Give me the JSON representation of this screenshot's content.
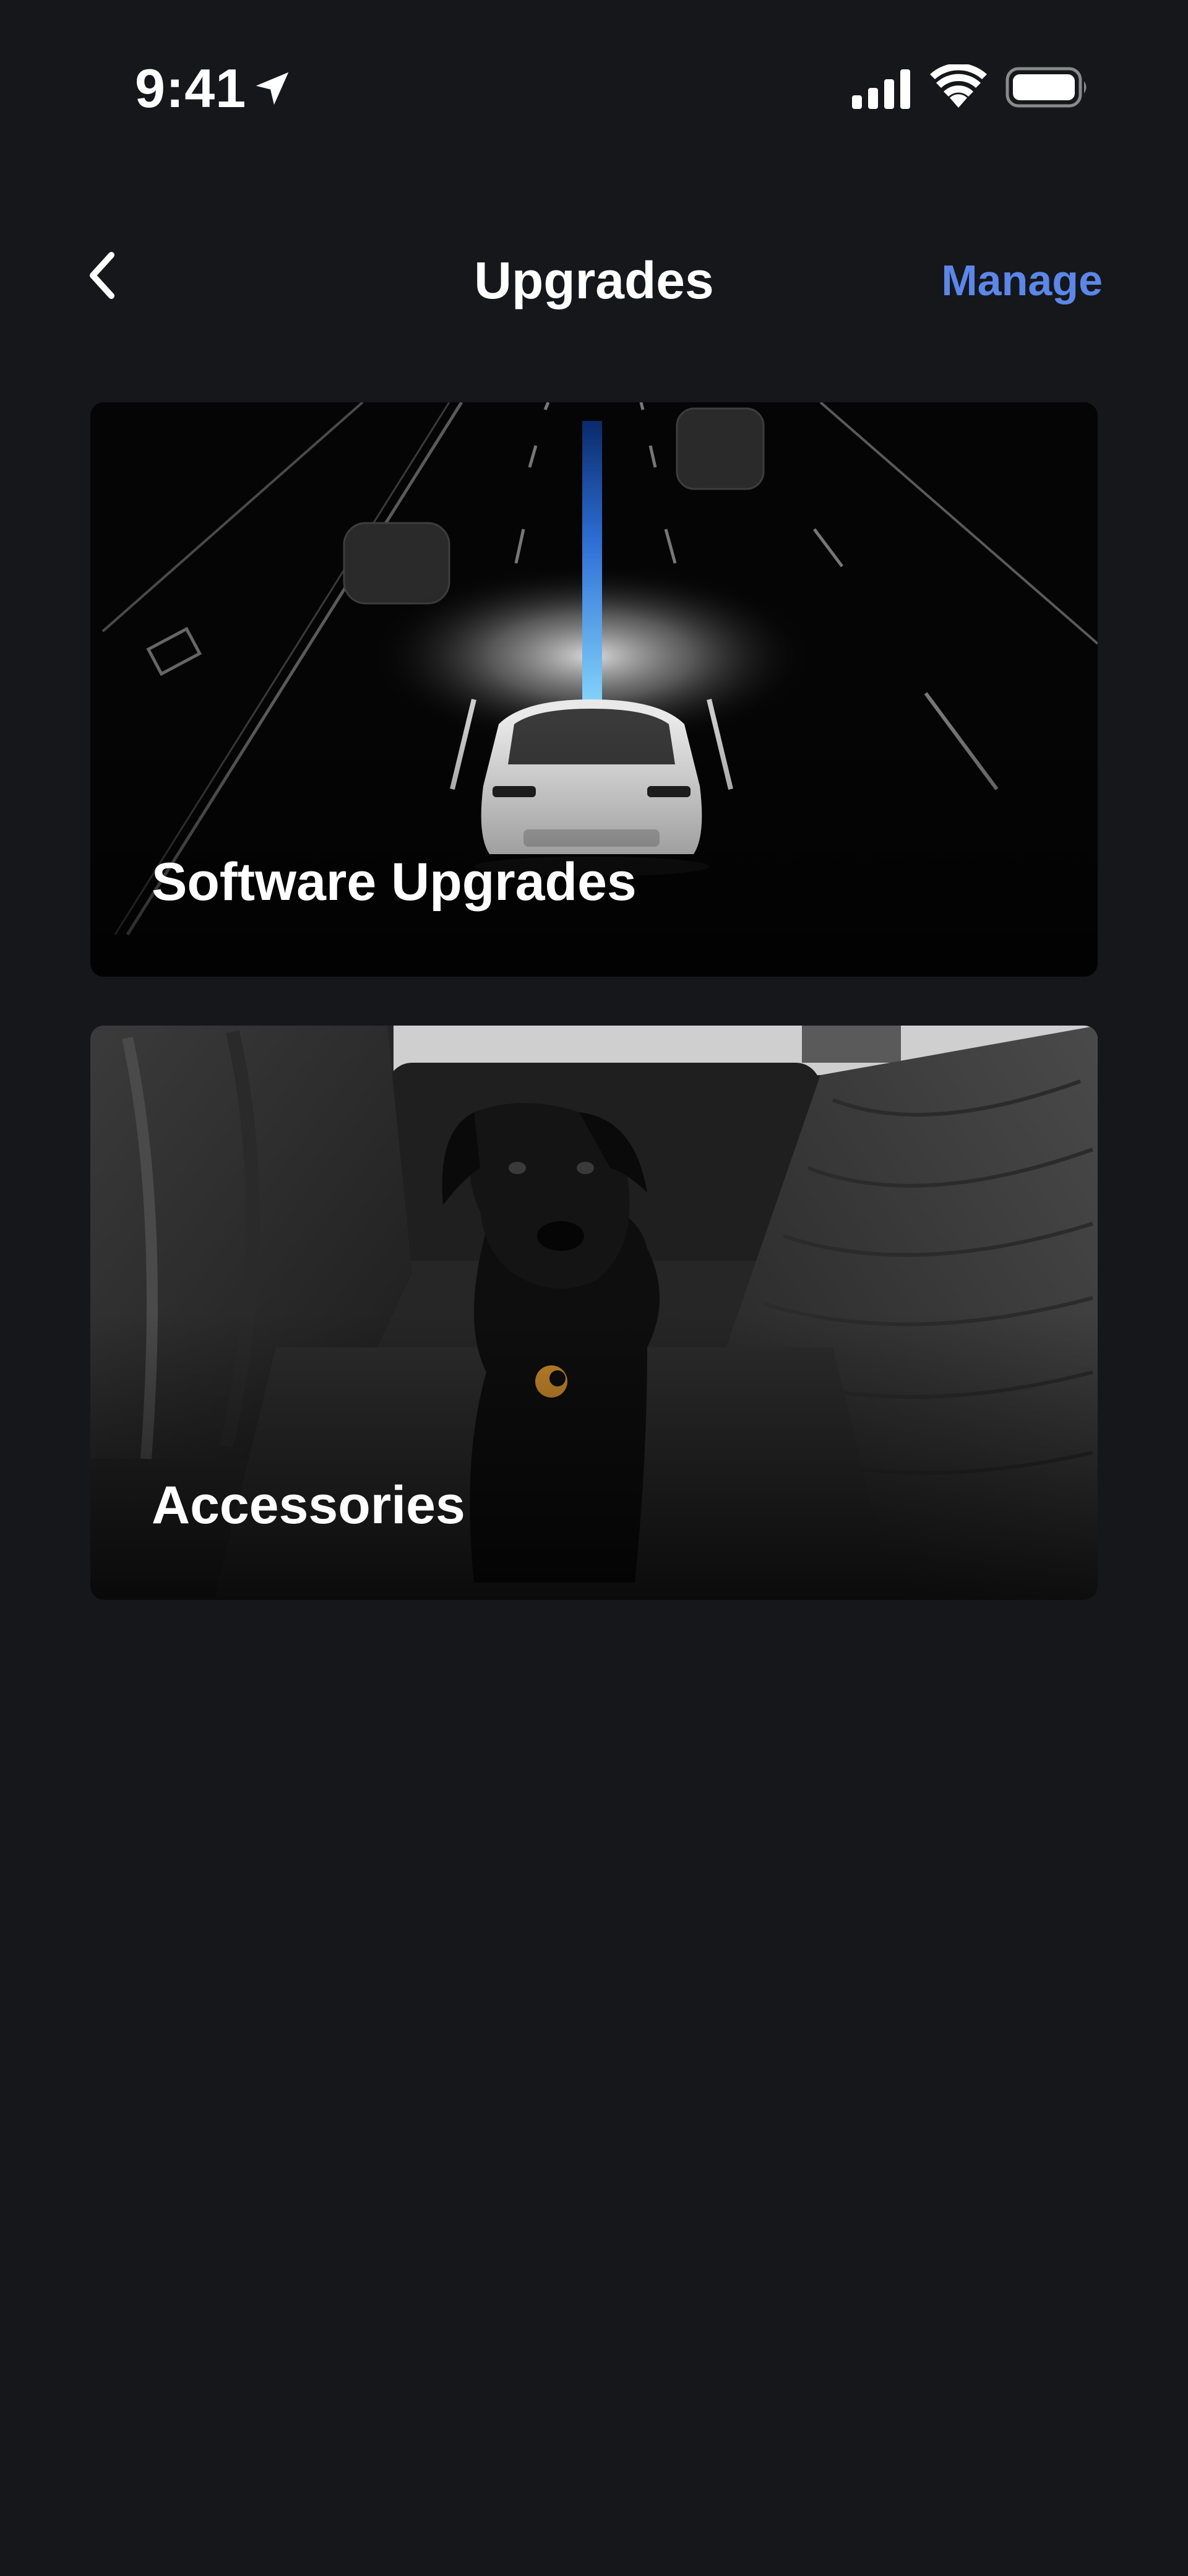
{
  "status_bar": {
    "time": "9:41",
    "icons": [
      "location-arrow-icon",
      "cellular-signal-icon",
      "wifi-icon",
      "battery-icon"
    ]
  },
  "nav": {
    "back_icon": "chevron-left-icon",
    "title": "Upgrades",
    "manage_label": "Manage"
  },
  "cards": [
    {
      "label": "Software Upgrades",
      "image": "highway-car-illustration"
    },
    {
      "label": "Accessories",
      "image": "dog-on-seat-cover-photo"
    }
  ],
  "colors": {
    "background": "#16171a",
    "accent": "#5b87e8",
    "text": "#ffffff"
  }
}
